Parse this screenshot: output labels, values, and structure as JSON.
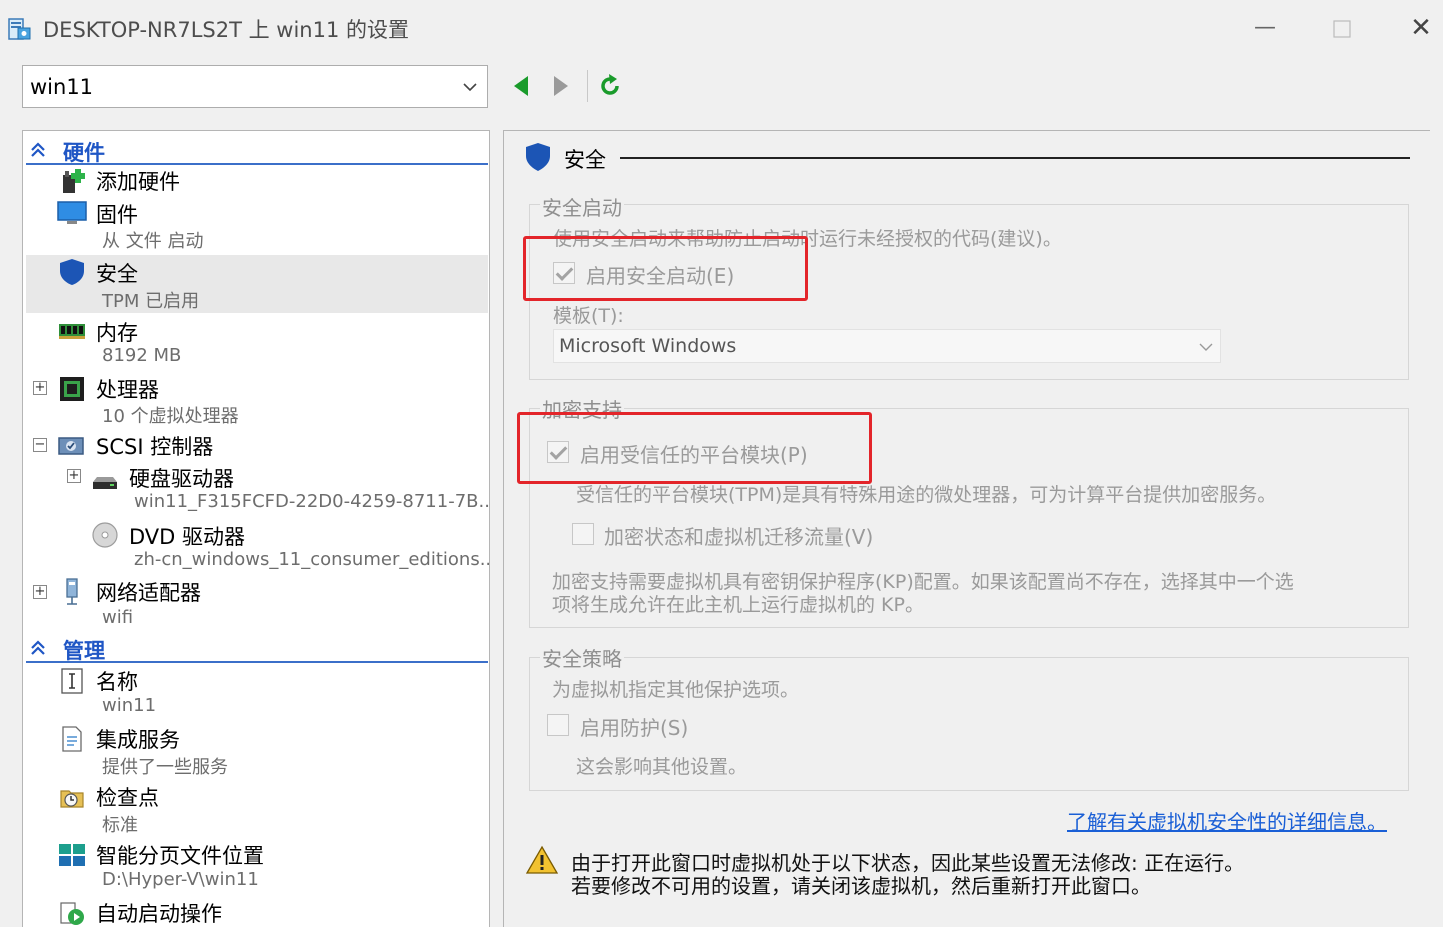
{
  "window": {
    "title": "DESKTOP-NR7LS2T 上 win11 的设置"
  },
  "vm_selector": {
    "value": "win11"
  },
  "left": {
    "hardware_header": "硬件",
    "management_header": "管理",
    "items": {
      "add_hardware": {
        "label": "添加硬件"
      },
      "firmware": {
        "label": "固件",
        "sub": "从 文件 启动"
      },
      "security": {
        "label": "安全",
        "sub": "TPM 已启用"
      },
      "memory": {
        "label": "内存",
        "sub": "8192 MB"
      },
      "processor": {
        "label": "处理器",
        "sub": "10 个虚拟处理器"
      },
      "scsi": {
        "label": "SCSI 控制器"
      },
      "hdd": {
        "label": "硬盘驱动器",
        "sub": "win11_F315FCFD-22D0-4259-8711-7B..."
      },
      "dvd": {
        "label": "DVD 驱动器",
        "sub": "zh-cn_windows_11_consumer_editions..."
      },
      "network": {
        "label": "网络适配器",
        "sub": "wifi"
      },
      "name": {
        "label": "名称",
        "sub": "win11"
      },
      "integration": {
        "label": "集成服务",
        "sub": "提供了一些服务"
      },
      "checkpoint": {
        "label": "检查点",
        "sub": "标准"
      },
      "paging": {
        "label": "智能分页文件位置",
        "sub": "D:\\Hyper-V\\win11"
      },
      "autostart": {
        "label": "自动启动操作"
      }
    }
  },
  "right": {
    "title": "安全",
    "secure_boot": {
      "group": "安全启动",
      "desc": "使用安全启动来帮助防止启动时运行未经授权的代码(建议)。",
      "enable_label": "启用安全启动(E)",
      "enable_checked": true,
      "template_label": "模板(T):",
      "template_value": "Microsoft Windows"
    },
    "encryption": {
      "group": "加密支持",
      "tpm_label": "启用受信任的平台模块(P)",
      "tpm_checked": true,
      "tpm_desc": "受信任的平台模块(TPM)是具有特殊用途的微处理器，可为计算平台提供加密服务。",
      "migration_label": "加密状态和虚拟机迁移流量(V)",
      "migration_checked": false,
      "kp_desc_1": "加密支持需要虚拟机具有密钥保护程序(KP)配置。如果该配置尚不存在，选择其中一个选",
      "kp_desc_2": "项将生成允许在此主机上运行虚拟机的 KP。"
    },
    "policy": {
      "group": "安全策略",
      "desc": "为虚拟机指定其他保护选项。",
      "shield_label": "启用防护(S)",
      "shield_checked": false,
      "shield_note": "这会影响其他设置。"
    },
    "learn_more": "了解有关虚拟机安全性的详细信息。",
    "warning_1": "由于打开此窗口时虚拟机处于以下状态，因此某些设置无法修改: 正在运行。",
    "warning_2": "若要修改不可用的设置，请关闭该虚拟机，然后重新打开此窗口。"
  },
  "colors": {
    "accent": "#1f56c5",
    "highlight_box": "#e3252a",
    "link": "#1a5fd6"
  }
}
